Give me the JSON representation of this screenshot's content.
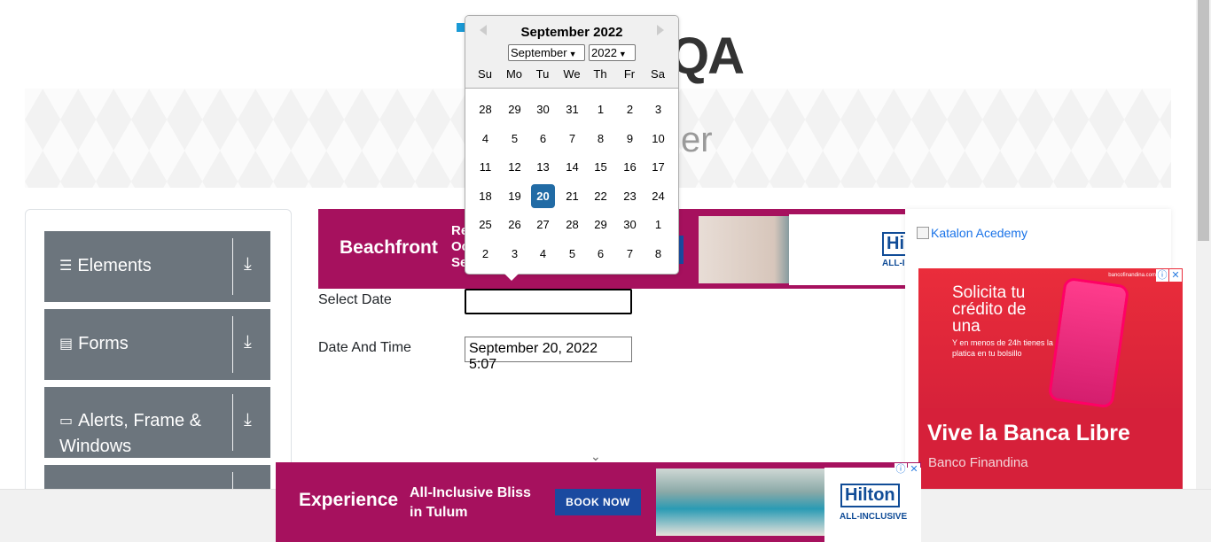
{
  "header": {
    "logo_text": "QA",
    "banner_title": "er"
  },
  "leftnav": {
    "groups": [
      {
        "icon": "list-icon",
        "label": "Elements"
      },
      {
        "icon": "form-icon",
        "label": "Forms"
      },
      {
        "icon": "window-icon",
        "label": "Alerts, Frame & Windows"
      }
    ]
  },
  "form": {
    "select_date_label": "Select Date",
    "select_date_value": "",
    "date_time_label": "Date And Time",
    "date_time_value": "September 20, 2022 5:07"
  },
  "datepicker": {
    "title": "September 2022",
    "month_select": "September",
    "year_select": "2022",
    "weekdays": [
      "Su",
      "Mo",
      "Tu",
      "We",
      "Th",
      "Fr",
      "Sa"
    ],
    "weeks": [
      [
        "28",
        "29",
        "30",
        "31",
        "1",
        "2",
        "3"
      ],
      [
        "4",
        "5",
        "6",
        "7",
        "8",
        "9",
        "10"
      ],
      [
        "11",
        "12",
        "13",
        "14",
        "15",
        "16",
        "17"
      ],
      [
        "18",
        "19",
        "20",
        "21",
        "22",
        "23",
        "24"
      ],
      [
        "25",
        "26",
        "27",
        "28",
        "29",
        "30",
        "1"
      ],
      [
        "2",
        "3",
        "4",
        "5",
        "6",
        "7",
        "8"
      ]
    ],
    "selected_day": "20",
    "selected_color": "#216ba5"
  },
  "ad_top": {
    "brand": "Beachfront",
    "text": "Re Oc Se",
    "logo": "Hil",
    "subtitle": "ALL-I"
  },
  "ad_bottom": {
    "brand": "Experience",
    "text": "All-Inclusive Bliss in Tulum",
    "button": "BOOK NOW",
    "logo": "Hilton",
    "subtitle": "ALL-INCLUSIVE"
  },
  "right_ads": {
    "katalon_alt": "Katalon Acedemy",
    "bank_headline": "Solicita tu crédito de una",
    "bank_small": "Y en menos de 24h tienes la platica en tu bolsillo",
    "bank_big": "Vive la Banca Libre",
    "bank_sub": "Banco Finandina",
    "bank_domain": "bancofinandina.com"
  }
}
